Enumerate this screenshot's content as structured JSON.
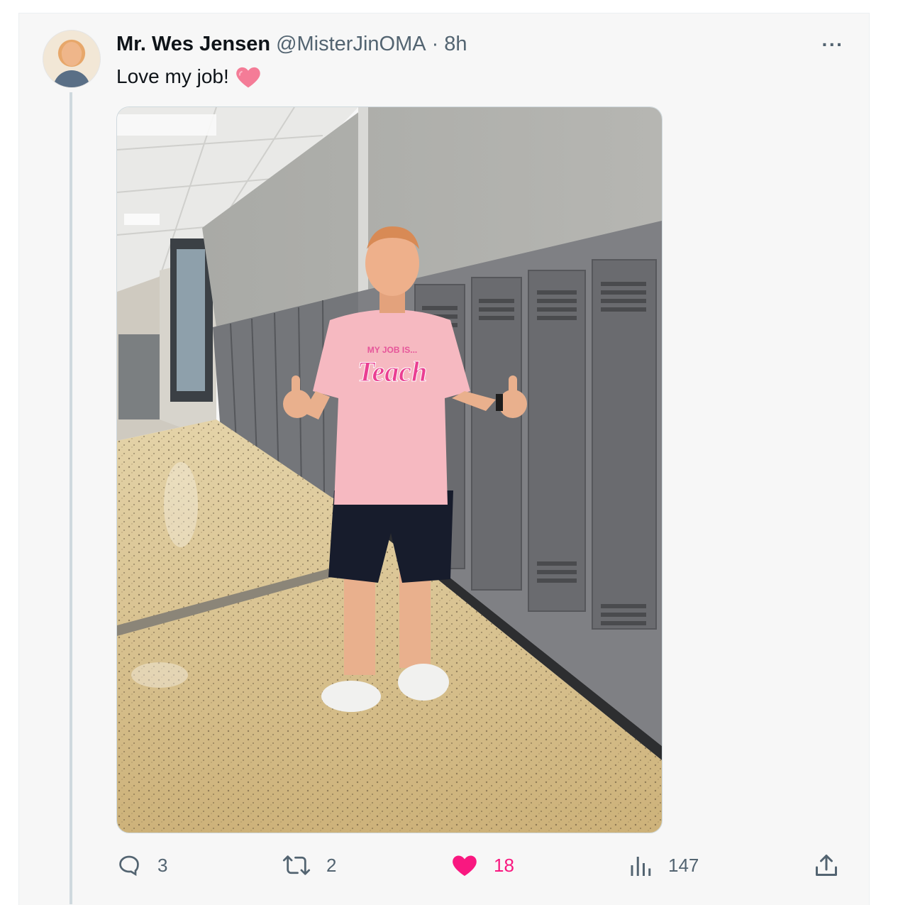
{
  "tweet": {
    "author_name": "Mr. Wes Jensen",
    "handle": "@MisterJinOMA",
    "separator": "·",
    "time": "8h",
    "text": "Love my job!",
    "emoji_icon": "pink-heart-emoji",
    "more_label": "···",
    "image": {
      "shirt_small_text": "MY JOB IS...",
      "shirt_big_text": "Teach"
    }
  },
  "actions": {
    "reply_count": "3",
    "retweet_count": "2",
    "like_count": "18",
    "view_count": "147"
  },
  "colors": {
    "like_pink": "#f91880",
    "muted_text": "#536471",
    "primary_text": "#0f1419"
  }
}
